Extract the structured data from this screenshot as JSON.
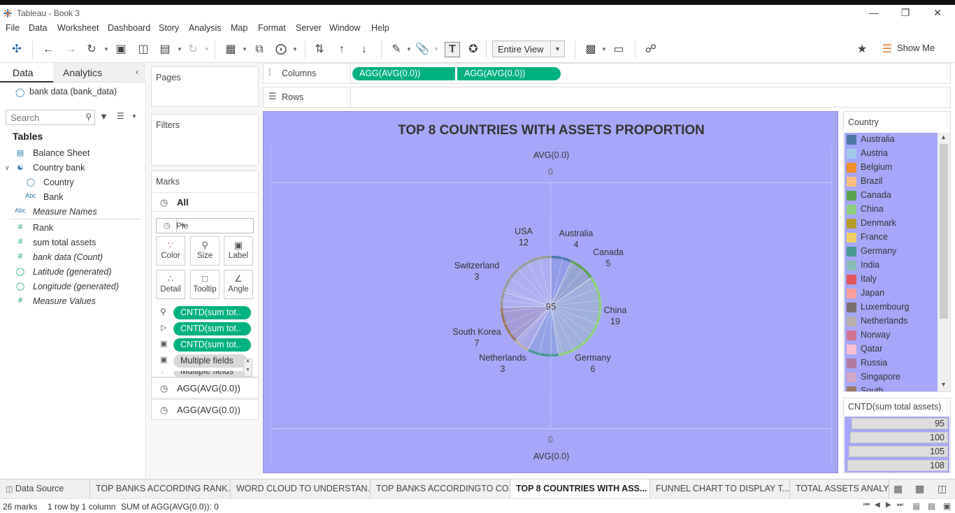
{
  "window": {
    "title": "Tableau - Book 3"
  },
  "menu": [
    "File",
    "Data",
    "Worksheet",
    "Dashboard",
    "Story",
    "Analysis",
    "Map",
    "Format",
    "Server",
    "Window",
    "Help"
  ],
  "toolbar": {
    "fit_value": "Entire View",
    "show_me": "Show Me"
  },
  "data_pane": {
    "tab_data": "Data",
    "tab_analytics": "Analytics",
    "datasource": "bank data (bank_data)",
    "search_placeholder": "Search",
    "tables_heading": "Tables",
    "fields": [
      {
        "label": "Balance Sheet",
        "icon": "table-icon"
      },
      {
        "label": "Country bank",
        "icon": "hierarchy-icon"
      },
      {
        "label": "Country",
        "icon": "globe-icon"
      },
      {
        "label": "Bank",
        "icon": "Abc"
      },
      {
        "label": "Measure Names",
        "icon": "Abc"
      },
      {
        "label": "Rank",
        "icon": "#"
      },
      {
        "label": "sum total assets",
        "icon": "#"
      },
      {
        "label": "bank data (Count)",
        "icon": "#"
      },
      {
        "label": "Latitude (generated)",
        "icon": "globe-icon"
      },
      {
        "label": "Longitude (generated)",
        "icon": "globe-icon"
      },
      {
        "label": "Measure Values",
        "icon": "#"
      }
    ]
  },
  "cards": {
    "pages": "Pages",
    "filters": "Filters",
    "marks": "Marks",
    "marks_all": "All",
    "mark_type": "Pie",
    "buttons": [
      "Color",
      "Size",
      "Label",
      "Detail",
      "Tooltip",
      "Angle"
    ],
    "mark_pills": [
      "CNTD(sum tot..",
      "CNTD(sum tot..",
      "CNTD(sum tot..",
      "Multiple fields",
      "Multiple fields"
    ],
    "agg_rows": [
      "AGG(AVG(0.0))",
      "AGG(AVG(0.0))"
    ]
  },
  "shelves": {
    "columns_label": "Columns",
    "rows_label": "Rows",
    "columns_pills": [
      "AGG(AVG(0.0))",
      "AGG(AVG(0.0))"
    ]
  },
  "viz": {
    "title": "TOP 8 COUNTRIES WITH ASSETS PROPORTION",
    "top_axis_title": "AVG(0.0)",
    "top_axis_tick": "0",
    "bottom_axis_title": "AVG(0.0)",
    "bottom_axis_tick": "0",
    "background": "#a6a7f9",
    "center_label": "95"
  },
  "chart_data": {
    "type": "pie",
    "title": "TOP 8 COUNTRIES WITH ASSETS PROPORTION",
    "total": 95,
    "categories": [
      "Australia",
      "Canada",
      "China",
      "Germany",
      "Netherlands",
      "South Korea",
      "Switzerland",
      "USA"
    ],
    "values": [
      4,
      5,
      19,
      6,
      3,
      7,
      3,
      12
    ]
  },
  "legend": {
    "title": "Country",
    "items": [
      {
        "name": "Australia",
        "color": "#4e79a7"
      },
      {
        "name": "Austria",
        "color": "#a0cbe8"
      },
      {
        "name": "Belgium",
        "color": "#f28e2b"
      },
      {
        "name": "Brazil",
        "color": "#ffbe7d"
      },
      {
        "name": "Canada",
        "color": "#59a14f"
      },
      {
        "name": "China",
        "color": "#8cd17d"
      },
      {
        "name": "Denmark",
        "color": "#b6992d"
      },
      {
        "name": "France",
        "color": "#f1ce63"
      },
      {
        "name": "Germany",
        "color": "#499894"
      },
      {
        "name": "India",
        "color": "#86bcb6"
      },
      {
        "name": "Italy",
        "color": "#e15759"
      },
      {
        "name": "Japan",
        "color": "#ff9d9a"
      },
      {
        "name": "Luxembourg",
        "color": "#79706e"
      },
      {
        "name": "Netherlands",
        "color": "#bab0ac"
      },
      {
        "name": "Norway",
        "color": "#d37295"
      },
      {
        "name": "Qatar",
        "color": "#fabfd2"
      },
      {
        "name": "Russia",
        "color": "#b07aa1"
      },
      {
        "name": "Singapore",
        "color": "#d4a6c8"
      },
      {
        "name": "South Korea",
        "color": "#9d7660"
      }
    ]
  },
  "size_legend": {
    "title": "CNTD(sum total assets)",
    "values": [
      "95",
      "100",
      "105",
      "108"
    ]
  },
  "sheet_tabs": {
    "data_source": "Data Source",
    "tabs": [
      "TOP BANKS ACCORDING RANK...",
      "WORD CLOUD TO UNDERSTAN...",
      "TOP BANKS ACCORDINGTO CO...",
      "TOP 8 COUNTRIES WITH ASS...",
      "FUNNEL CHART TO DISPLAY T...",
      "TOTAL ASSETS ANALYS"
    ],
    "active_index": 3
  },
  "status": {
    "marks": "26 marks",
    "rows_cols": "1 row by 1 column",
    "sum": "SUM of AGG(AVG(0.0)): 0"
  }
}
